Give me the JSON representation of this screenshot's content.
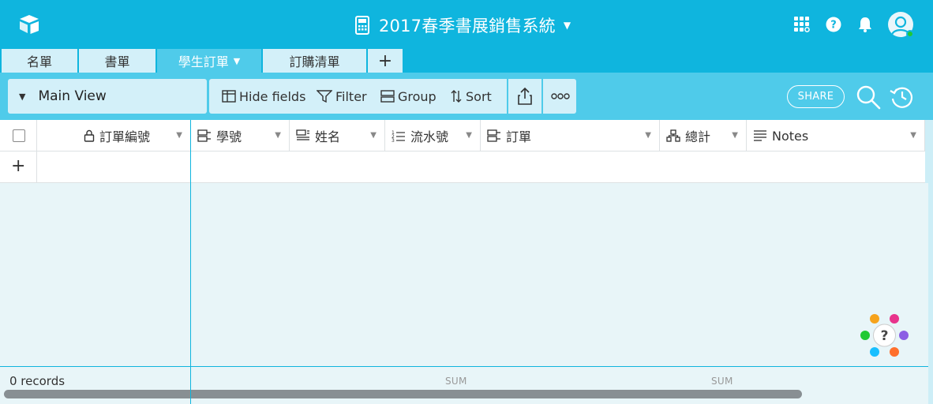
{
  "app": {
    "title": "2017春季書展銷售系統",
    "accent_color": "#0fb5de"
  },
  "topbar_icons": [
    "apps-grid-icon",
    "help-icon",
    "bell-icon",
    "user-avatar"
  ],
  "tabs": [
    {
      "label": "名單"
    },
    {
      "label": "書單"
    },
    {
      "label": "學生訂單",
      "active": true
    },
    {
      "label": "訂購清單"
    },
    {
      "label": "+"
    }
  ],
  "viewbar": {
    "view_name": "Main View",
    "hide_fields": "Hide fields",
    "filter": "Filter",
    "group": "Group",
    "sort": "Sort",
    "share": "SHARE"
  },
  "columns": [
    {
      "label": "訂單編號",
      "icon": "lock-icon"
    },
    {
      "label": "學號",
      "icon": "link-icon"
    },
    {
      "label": "姓名",
      "icon": "lookup-icon"
    },
    {
      "label": "流水號",
      "icon": "autonumber-icon"
    },
    {
      "label": "訂單",
      "icon": "link-icon"
    },
    {
      "label": "總計",
      "icon": "rollup-icon"
    },
    {
      "label": "Notes",
      "icon": "long-text-icon"
    }
  ],
  "footer": {
    "records": "0 records",
    "sum_1": "SUM",
    "sum_2": "SUM"
  },
  "help_label": "?"
}
